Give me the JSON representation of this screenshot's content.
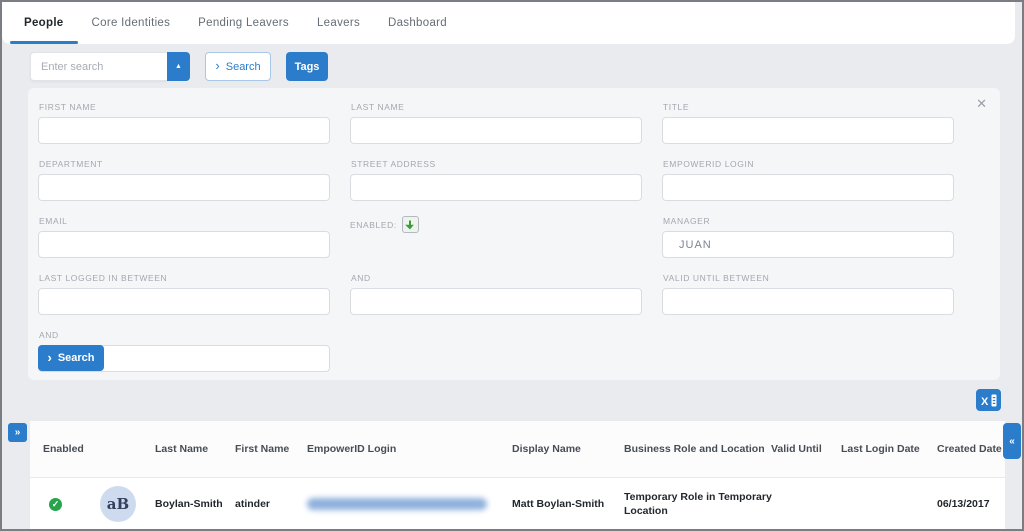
{
  "tabs": [
    {
      "label": "People",
      "active": true
    },
    {
      "label": "Core Identities",
      "active": false
    },
    {
      "label": "Pending Leavers",
      "active": false
    },
    {
      "label": "Leavers",
      "active": false
    },
    {
      "label": "Dashboard",
      "active": false
    }
  ],
  "toolbar": {
    "search_placeholder": "Enter search",
    "search_button": "Search",
    "tags_button": "Tags"
  },
  "icons": {
    "dropdown_up": "▲",
    "chevron_right": "›",
    "close": "✕",
    "expand": "»",
    "collapse": "«",
    "check": "✓"
  },
  "filter_panel": {
    "labels": {
      "first_name": "FIRST NAME",
      "last_name": "LAST NAME",
      "title": "TITLE",
      "department": "DEPARTMENT",
      "street_address": "STREET ADDRESS",
      "empowerid_login": "EMPOWERID LOGIN",
      "email": "EMAIL",
      "enabled": "ENABLED:",
      "manager": "MANAGER",
      "last_logged_in_between": "LAST LOGGED IN BETWEEN",
      "and_middle": "AND",
      "valid_until_between": "VALID UNTIL BETWEEN",
      "and_bottom": "AND"
    },
    "values": {
      "manager": "JUAN"
    },
    "search_button": "Search"
  },
  "table": {
    "headers": {
      "enabled": "Enabled",
      "avatar": "",
      "last_name": "Last Name",
      "first_name": "First Name",
      "empowerid_login": "EmpowerID Login",
      "display_name": "Display Name",
      "business_role": "Business Role and Location",
      "valid_until": "Valid Until",
      "last_login_date": "Last Login Date",
      "created_date": "Created Date"
    },
    "row": {
      "enabled": true,
      "avatar_initials": "aB",
      "last_name": "Boylan-Smith",
      "first_name": "atinder",
      "empowerid_login": "[blurred]",
      "display_name": "Matt Boylan-Smith",
      "business_role_and_location": "Temporary Role in Temporary Location",
      "valid_until": "",
      "last_login_date": "",
      "created_date": "06/13/2017"
    }
  },
  "colors": {
    "primary_blue": "#2b7cca",
    "success_green": "#27a34a",
    "panel_bg": "#f5f6f8",
    "page_bg": "#e9ebee"
  }
}
